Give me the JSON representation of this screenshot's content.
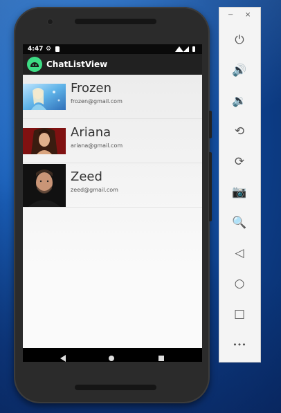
{
  "status_bar": {
    "time": "4:47"
  },
  "app_bar": {
    "title": "ChatListView"
  },
  "contacts": [
    {
      "name": "Frozen",
      "email": "frozen@gmail.com"
    },
    {
      "name": "Ariana",
      "email": "ariana@gmail.com"
    },
    {
      "name": "Zeed",
      "email": "zeed@gmail.com"
    }
  ],
  "emulator_controls": {
    "minimize": "−",
    "close": "×",
    "tools": [
      {
        "icon": "power-icon",
        "glyph": "⏻"
      },
      {
        "icon": "volume-up-icon",
        "glyph": "🔊"
      },
      {
        "icon": "volume-down-icon",
        "glyph": "🔉"
      },
      {
        "icon": "rotate-left-icon",
        "glyph": "⟲"
      },
      {
        "icon": "rotate-right-icon",
        "glyph": "⟳"
      },
      {
        "icon": "camera-icon",
        "glyph": "📷"
      },
      {
        "icon": "zoom-icon",
        "glyph": "🔍"
      },
      {
        "icon": "back-icon",
        "glyph": "◁"
      },
      {
        "icon": "home-icon",
        "glyph": "○"
      },
      {
        "icon": "overview-icon",
        "glyph": "□"
      },
      {
        "icon": "more-icon",
        "glyph": "•••"
      }
    ]
  },
  "colors": {
    "app_bar": "#212121",
    "accent": "#3ddc84"
  }
}
